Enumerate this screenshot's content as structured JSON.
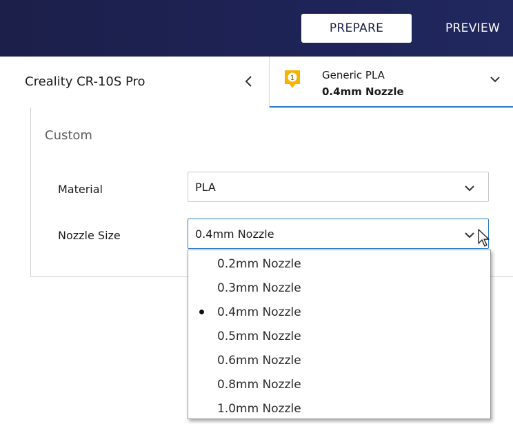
{
  "top_tabs": {
    "prepare": "PREPARE",
    "preview": "PREVIEW"
  },
  "printer": {
    "name": "Creality CR-10S Pro"
  },
  "extruder": {
    "number": "1",
    "material": "Generic PLA",
    "nozzle": "0.4mm Nozzle"
  },
  "custom_panel": {
    "title": "Custom",
    "material_label": "Material",
    "material_value": "PLA",
    "nozzle_label": "Nozzle Size",
    "nozzle_value": "0.4mm Nozzle"
  },
  "nozzle_options": [
    {
      "label": "0.2mm Nozzle",
      "selected": false
    },
    {
      "label": "0.3mm Nozzle",
      "selected": false
    },
    {
      "label": "0.4mm Nozzle",
      "selected": true
    },
    {
      "label": "0.5mm Nozzle",
      "selected": false
    },
    {
      "label": "0.6mm Nozzle",
      "selected": false
    },
    {
      "label": "0.8mm Nozzle",
      "selected": false
    },
    {
      "label": "1.0mm Nozzle",
      "selected": false
    }
  ],
  "colors": {
    "topbar": "#1b1f49",
    "accent": "#2c79c8",
    "badge": "#f5b400"
  },
  "icons": {
    "collapse": "chevron-left-icon",
    "expand": "chevron-down-icon",
    "extruder": "extruder-badge-icon",
    "cursor": "mouse-pointer-icon"
  }
}
